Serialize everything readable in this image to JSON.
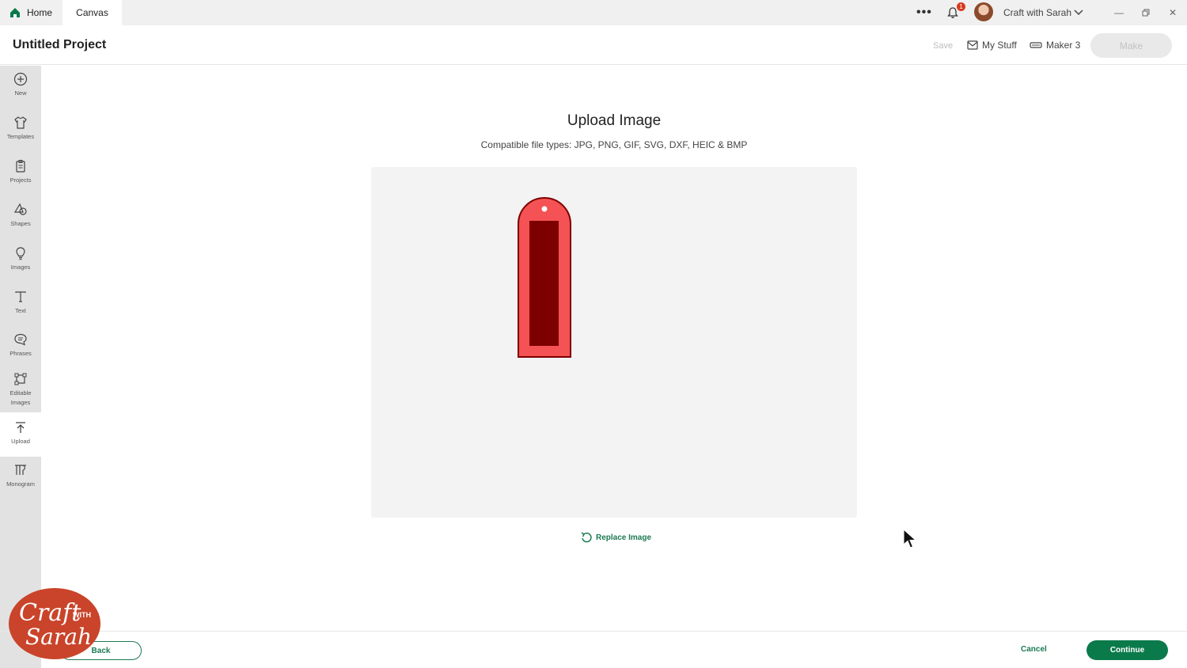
{
  "titlebar": {
    "tabs": [
      {
        "label": "Home"
      },
      {
        "label": "Canvas"
      }
    ],
    "notification_count": "1",
    "username": "Craft with Sarah"
  },
  "header": {
    "project_title": "Untitled Project",
    "save_label": "Save",
    "my_stuff_label": "My Stuff",
    "machine_label": "Maker 3",
    "make_label": "Make"
  },
  "sidebar": {
    "items": [
      {
        "label": "New",
        "icon": "plus-circle-icon"
      },
      {
        "label": "Templates",
        "icon": "shirt-icon"
      },
      {
        "label": "Projects",
        "icon": "clipboard-icon"
      },
      {
        "label": "Shapes",
        "icon": "shapes-icon"
      },
      {
        "label": "Images",
        "icon": "lightbulb-icon"
      },
      {
        "label": "Text",
        "icon": "text-icon"
      },
      {
        "label": "Phrases",
        "icon": "speech-bubble-icon"
      },
      {
        "label": "Editable Images",
        "icon": "editable-image-icon"
      },
      {
        "label": "Upload",
        "icon": "upload-icon",
        "active": true
      },
      {
        "label": "Monogram",
        "icon": "monogram-icon"
      }
    ]
  },
  "main": {
    "title": "Upload Image",
    "file_types": "Compatible file types:  JPG, PNG, GIF, SVG, DXF, HEIC & BMP",
    "replace_label": "Replace Image"
  },
  "footer": {
    "back_label": "Back",
    "cancel_label": "Cancel",
    "continue_label": "Continue"
  },
  "watermark": {
    "line1": "Craft",
    "line2": "WITH",
    "line3": "Sarah"
  },
  "colors": {
    "accent": "#0b7a4b",
    "tag_outer": "#f45254",
    "tag_inner": "#7d0000",
    "watermark_bg": "#c9442a"
  }
}
